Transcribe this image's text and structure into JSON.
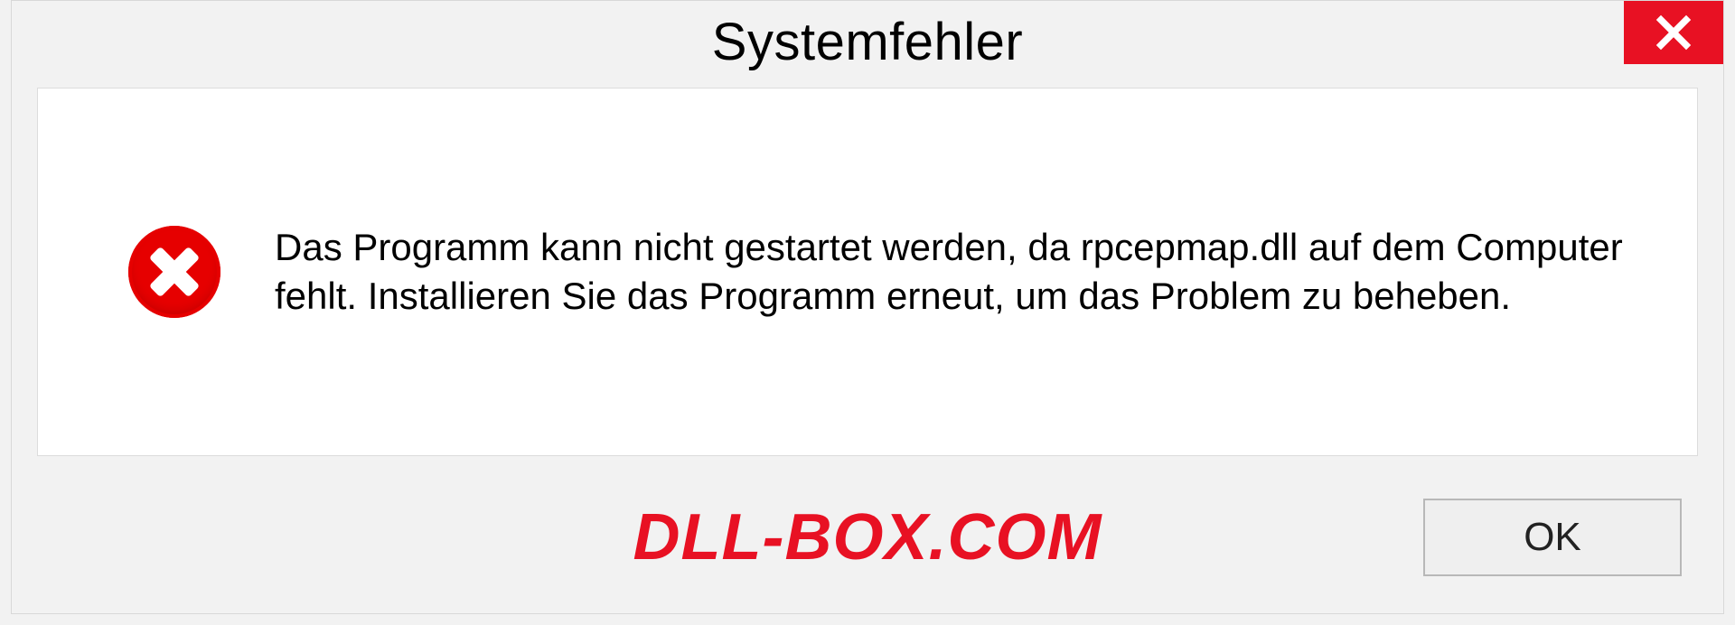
{
  "dialog": {
    "title": "Systemfehler",
    "message": "Das Programm kann nicht gestartet werden, da rpcepmap.dll auf dem Computer fehlt. Installieren Sie das Programm erneut, um das Problem zu beheben.",
    "ok_label": "OK"
  },
  "watermark": "DLL-BOX.COM",
  "icons": {
    "close": "close-icon",
    "error": "error-circle-x-icon"
  },
  "colors": {
    "accent_red": "#e81123",
    "error_red": "#e60000",
    "panel_bg": "#ffffff",
    "dialog_bg": "#f2f2f2",
    "border": "#d8d8d8"
  }
}
